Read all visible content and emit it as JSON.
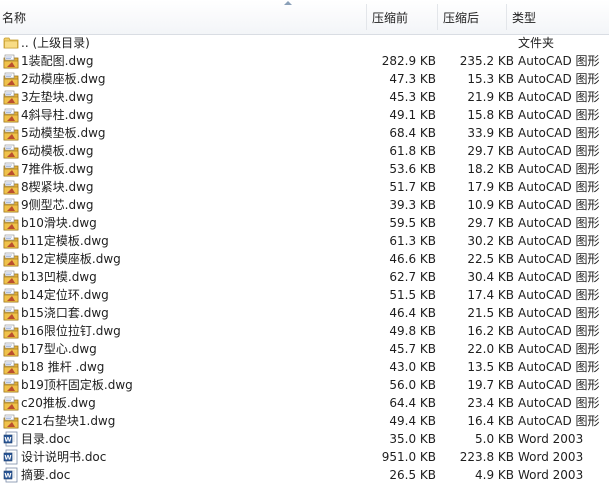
{
  "columns": {
    "name": "名称",
    "original_size": "压缩前",
    "compressed_size": "压缩后",
    "type": "类型"
  },
  "rows": [
    {
      "icon": "folder-icon",
      "name": ".. (上级目录)",
      "original": "",
      "compressed": "",
      "type": "文件夹"
    },
    {
      "icon": "dwg-file-icon",
      "name": "1装配图.dwg",
      "original": "282.9 KB",
      "compressed": "235.2 KB",
      "type": "AutoCAD 图形"
    },
    {
      "icon": "dwg-file-icon",
      "name": "2动模座板.dwg",
      "original": "47.3 KB",
      "compressed": "15.3 KB",
      "type": "AutoCAD 图形"
    },
    {
      "icon": "dwg-file-icon",
      "name": "3左垫块.dwg",
      "original": "45.3 KB",
      "compressed": "21.9 KB",
      "type": "AutoCAD 图形"
    },
    {
      "icon": "dwg-file-icon",
      "name": "4斜导柱.dwg",
      "original": "49.1 KB",
      "compressed": "15.8 KB",
      "type": "AutoCAD 图形"
    },
    {
      "icon": "dwg-file-icon",
      "name": "5动模垫板.dwg",
      "original": "68.4 KB",
      "compressed": "33.9 KB",
      "type": "AutoCAD 图形"
    },
    {
      "icon": "dwg-file-icon",
      "name": "6动模板.dwg",
      "original": "61.8 KB",
      "compressed": "29.7 KB",
      "type": "AutoCAD 图形"
    },
    {
      "icon": "dwg-file-icon",
      "name": "7推件板.dwg",
      "original": "53.6 KB",
      "compressed": "18.2 KB",
      "type": "AutoCAD 图形"
    },
    {
      "icon": "dwg-file-icon",
      "name": "8楔紧块.dwg",
      "original": "51.7 KB",
      "compressed": "17.9 KB",
      "type": "AutoCAD 图形"
    },
    {
      "icon": "dwg-file-icon",
      "name": "9侧型芯.dwg",
      "original": "39.3 KB",
      "compressed": "10.9 KB",
      "type": "AutoCAD 图形"
    },
    {
      "icon": "dwg-file-icon",
      "name": "b10滑块.dwg",
      "original": "59.5 KB",
      "compressed": "29.7 KB",
      "type": "AutoCAD 图形"
    },
    {
      "icon": "dwg-file-icon",
      "name": "b11定模板.dwg",
      "original": "61.3 KB",
      "compressed": "30.2 KB",
      "type": "AutoCAD 图形"
    },
    {
      "icon": "dwg-file-icon",
      "name": "b12定模座板.dwg",
      "original": "46.6 KB",
      "compressed": "22.5 KB",
      "type": "AutoCAD 图形"
    },
    {
      "icon": "dwg-file-icon",
      "name": "b13凹模.dwg",
      "original": "62.7 KB",
      "compressed": "30.4 KB",
      "type": "AutoCAD 图形"
    },
    {
      "icon": "dwg-file-icon",
      "name": "b14定位环.dwg",
      "original": "51.5 KB",
      "compressed": "17.4 KB",
      "type": "AutoCAD 图形"
    },
    {
      "icon": "dwg-file-icon",
      "name": "b15浇口套.dwg",
      "original": "46.4 KB",
      "compressed": "21.5 KB",
      "type": "AutoCAD 图形"
    },
    {
      "icon": "dwg-file-icon",
      "name": "b16限位拉钉.dwg",
      "original": "49.8 KB",
      "compressed": "16.2 KB",
      "type": "AutoCAD 图形"
    },
    {
      "icon": "dwg-file-icon",
      "name": "b17型心.dwg",
      "original": "45.7 KB",
      "compressed": "22.0 KB",
      "type": "AutoCAD 图形"
    },
    {
      "icon": "dwg-file-icon",
      "name": "b18 推杆 .dwg",
      "original": "43.0 KB",
      "compressed": "13.5 KB",
      "type": "AutoCAD 图形"
    },
    {
      "icon": "dwg-file-icon",
      "name": "b19顶杆固定板.dwg",
      "original": "56.0 KB",
      "compressed": "19.7 KB",
      "type": "AutoCAD 图形"
    },
    {
      "icon": "dwg-file-icon",
      "name": "c20推板.dwg",
      "original": "64.4 KB",
      "compressed": "23.4 KB",
      "type": "AutoCAD 图形"
    },
    {
      "icon": "dwg-file-icon",
      "name": "c21右垫块1.dwg",
      "original": "49.4 KB",
      "compressed": "16.4 KB",
      "type": "AutoCAD 图形"
    },
    {
      "icon": "word-doc-icon",
      "name": "目录.doc",
      "original": "35.0 KB",
      "compressed": "5.0 KB",
      "type": "Word 2003"
    },
    {
      "icon": "word-doc-icon",
      "name": "设计说明书.doc",
      "original": "951.0 KB",
      "compressed": "223.8 KB",
      "type": "Word 2003"
    },
    {
      "icon": "word-doc-icon",
      "name": "摘要.doc",
      "original": "26.5 KB",
      "compressed": "4.9 KB",
      "type": "Word 2003"
    }
  ]
}
